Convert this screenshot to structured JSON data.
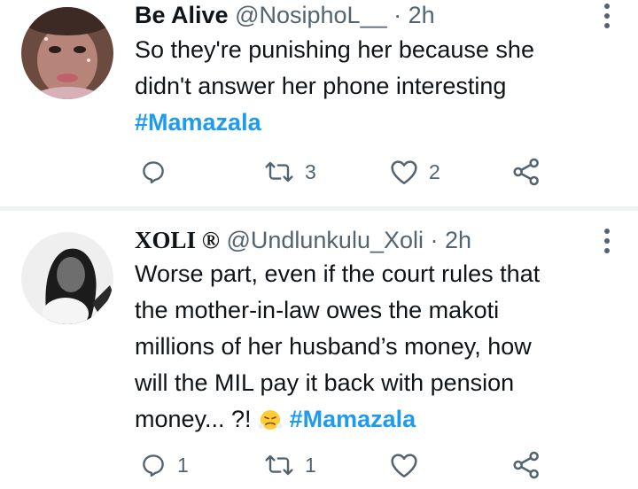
{
  "tweets": [
    {
      "display_name": "Be Alive",
      "handle": "@NosiphoL__",
      "time": "· 2h",
      "text_lines": [
        "So they're punishing her because she",
        "didn't answer her phone interesting"
      ],
      "hashtag": "#Mamazala",
      "actions": {
        "reply_count": "",
        "retweet_count": "3",
        "like_count": "2"
      },
      "avatar_icon": "profile-photo-woman-face"
    },
    {
      "display_name": "XOLI ®",
      "handle": "@Undlunkulu_Xoli",
      "time": "· 2h",
      "text_lines": [
        "Worse part, even if the court rules that",
        "the mother-in-law owes the makoti",
        "millions of her husband’s money, how",
        "will the MIL pay it back with pension"
      ],
      "last_line_text": "money... ?!",
      "emoji": "face-with-steam-from-nose",
      "hashtag": "#Mamazala",
      "actions": {
        "reply_count": "1",
        "retweet_count": "1",
        "like_count": ""
      },
      "avatar_icon": "profile-photo-woman-black-white"
    }
  ],
  "icons": {
    "reply": "reply-icon",
    "retweet": "retweet-icon",
    "like": "heart-icon",
    "share": "share-icon",
    "more": "more-options-icon"
  },
  "colors": {
    "hashtag": "#1d9bf0",
    "muted": "#536471",
    "text": "#0f1419"
  }
}
